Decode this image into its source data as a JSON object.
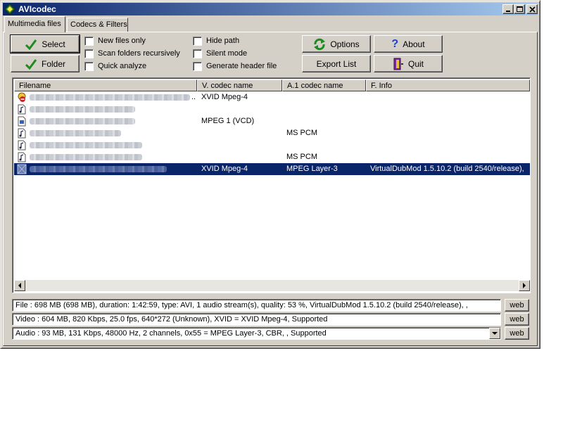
{
  "window": {
    "title": "AVIcodec"
  },
  "tabs": [
    {
      "label": "Multimedia files",
      "active": true
    },
    {
      "label": "Codecs & Filters",
      "active": false
    }
  ],
  "buttons": {
    "select": "Select",
    "folder": "Folder",
    "options": "Options",
    "about": "About",
    "export_list": "Export List",
    "quit": "Quit"
  },
  "checkboxes": [
    {
      "label": "New files only",
      "checked": false
    },
    {
      "label": "Scan folders recursively",
      "checked": false
    },
    {
      "label": "Quick analyze",
      "checked": false
    },
    {
      "label": "Hide path",
      "checked": false
    },
    {
      "label": "Silent mode",
      "checked": false
    },
    {
      "label": "Generate header file",
      "checked": false
    }
  ],
  "list": {
    "columns": [
      "Filename",
      "V. codec name",
      "A.1 codec name",
      "F. Info"
    ],
    "rows": [
      {
        "filename_ellipsis": "..",
        "vcodec": "XVID Mpeg-4",
        "acodec": "",
        "finfo": "",
        "icon": "error-file-icon",
        "selected": false
      },
      {
        "filename_ellipsis": "",
        "vcodec": "",
        "acodec": "",
        "finfo": "",
        "icon": "audio-file-icon",
        "selected": false
      },
      {
        "filename_ellipsis": "",
        "vcodec": "MPEG 1 (VCD)",
        "acodec": "",
        "finfo": "",
        "icon": "video-file-icon",
        "selected": false
      },
      {
        "filename_ellipsis": "",
        "vcodec": "",
        "acodec": "MS PCM",
        "finfo": "",
        "icon": "audio-file-icon",
        "selected": false
      },
      {
        "filename_ellipsis": "",
        "vcodec": "",
        "acodec": "",
        "finfo": "",
        "icon": "audio-file-icon",
        "selected": false
      },
      {
        "filename_ellipsis": "",
        "vcodec": "",
        "acodec": "MS PCM",
        "finfo": "",
        "icon": "audio-file-icon",
        "selected": false
      },
      {
        "filename_ellipsis": "",
        "vcodec": "XVID Mpeg-4",
        "acodec": "MPEG Layer-3",
        "finfo": "VirtualDubMod 1.5.10.2 (build 2540/release),",
        "icon": "video-file-icon",
        "selected": true
      }
    ]
  },
  "details": {
    "file": "File    :  698 MB (698 MB),  duration: 1:42:59,  type: AVI,  1 audio stream(s),  quality: 53 %, VirtualDubMod 1.5.10.2 (build 2540/release), ,",
    "video": "Video :  604 MB,  820 Kbps,  25.0 fps,  640*272 (Unknown),  XVID = XVID Mpeg-4,    Supported",
    "audio": "Audio :  93 MB,  131 Kbps,  48000 Hz,  2 channels,  0x55 = MPEG Layer-3,  CBR, ,    Supported",
    "web_label": "web"
  },
  "colors": {
    "titlebar_start": "#0a246a",
    "titlebar_end": "#a6caf0",
    "selection": "#0a246a",
    "face": "#d4d0c8"
  }
}
